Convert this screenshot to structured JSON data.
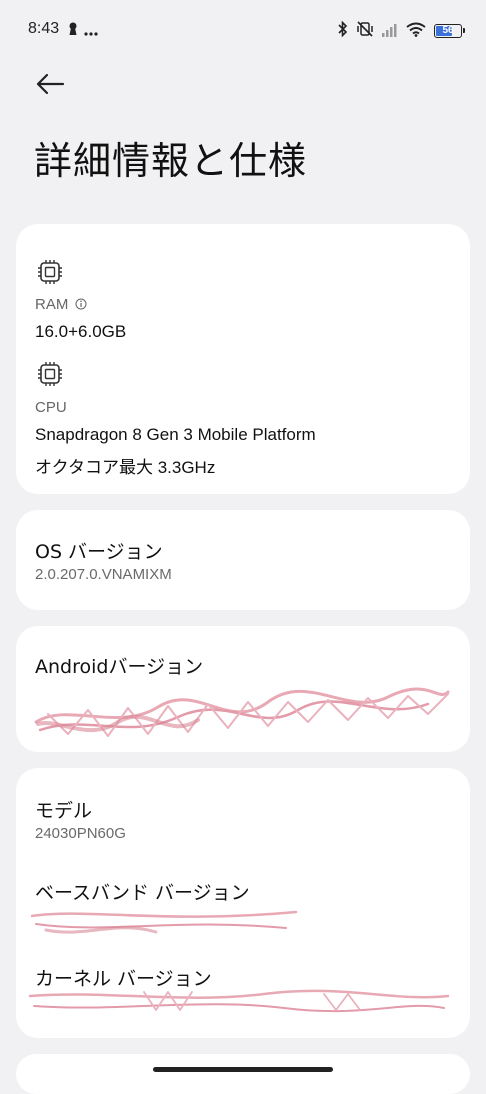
{
  "status_bar": {
    "time": "8:43",
    "left_icons": [
      "keyhole-icon",
      "more-dots-icon"
    ],
    "right_icons": [
      "bluetooth-icon",
      "vibrate-off-icon",
      "signal-icon",
      "wifi-icon",
      "battery-icon"
    ],
    "battery_level": "56",
    "battery_color": "#3b6fd9"
  },
  "header": {
    "back_icon": "back-arrow-icon",
    "title": "詳細情報と仕様"
  },
  "specs": {
    "ram": {
      "icon": "chip-icon",
      "label": "RAM",
      "info_icon": "info-circle-icon",
      "value": "16.0+6.0GB"
    },
    "cpu": {
      "icon": "chip-icon",
      "label": "CPU",
      "value_line1": "Snapdragon 8 Gen 3 Mobile Platform",
      "value_line2": "オクタコア最大 3.3GHz"
    }
  },
  "os_version": {
    "title": "OS バージョン",
    "value": "2.0.207.0.VNAMIXM"
  },
  "android_version": {
    "title": "Androidバージョン"
  },
  "device_info": {
    "model_title": "モデル",
    "model_value": "24030PN60G",
    "baseband_title": "ベースバンド バージョン",
    "kernel_title": "カーネル バージョン"
  },
  "colors": {
    "background": "#f1f1f3",
    "card": "#ffffff",
    "redaction_scribble": "#e8a8b4"
  }
}
